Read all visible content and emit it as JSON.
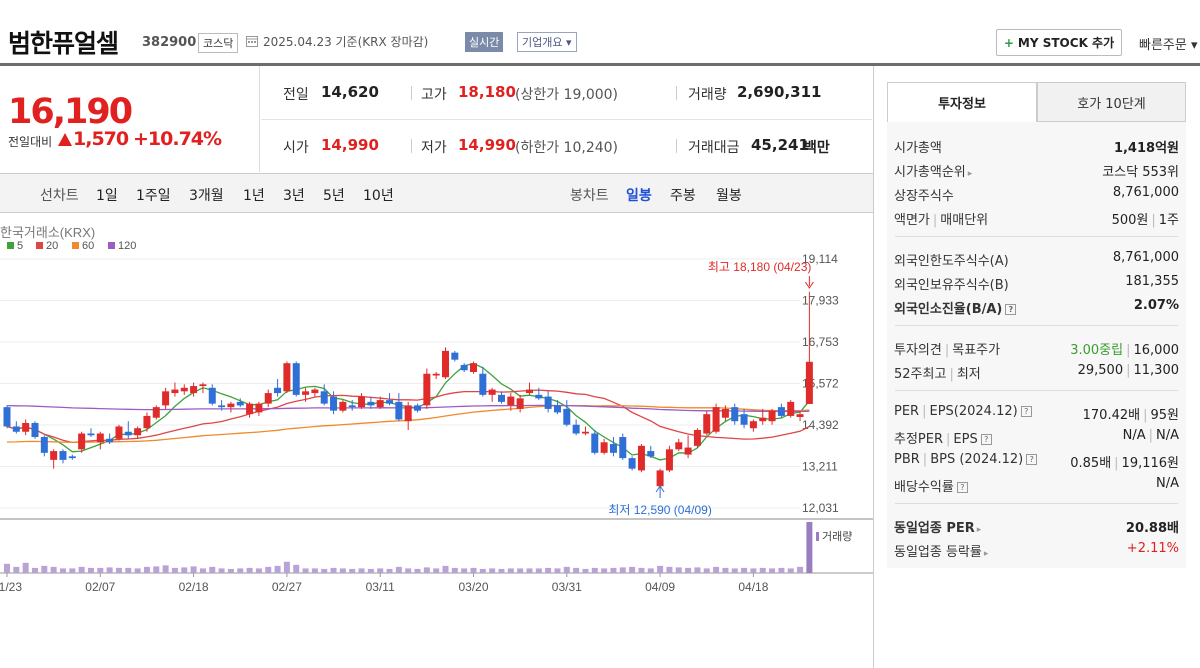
{
  "header": {
    "stock_name": "범한퓨얼셀",
    "stock_code": "382900",
    "market": "코스닥",
    "date_text": "2025.04.23  기준(KRX 장마감)",
    "realtime_label": "실시간",
    "corp_overview_label": "기업개요 ▾",
    "my_stock_label": "MY STOCK 추가",
    "quick_order_label": "빠른주문 ▾"
  },
  "price": {
    "current": "16,190",
    "change_label": "전일대비",
    "change_value": "1,570",
    "change_pct": "+10.74%"
  },
  "quote": {
    "prev_label": "전일",
    "prev": "14,620",
    "high_label": "고가",
    "high": "18,180",
    "upper_limit": "(상한가 19,000)",
    "volume_label": "거래량",
    "volume": "2,690,311",
    "open_label": "시가",
    "open": "14,990",
    "low_label": "저가",
    "low": "14,990",
    "lower_limit": "(하한가 10,240)",
    "value_label": "거래대금",
    "value": "45,241",
    "value_unit": "백만"
  },
  "range_bar": {
    "line_label": "선차트",
    "periods": [
      "1일",
      "1주일",
      "3개월",
      "1년",
      "3년",
      "5년",
      "10년"
    ],
    "candle_label": "봉차트",
    "candle_periods": [
      "일봉",
      "주봉",
      "월봉"
    ],
    "active_candle": "일봉"
  },
  "chart_data": {
    "type": "candlestick",
    "source_label": "한국거래소(KRX)",
    "legend": [
      {
        "name": "5",
        "color": "#3ca33c"
      },
      {
        "name": "20",
        "color": "#e04545"
      },
      {
        "name": "60",
        "color": "#f08a2a"
      },
      {
        "name": "120",
        "color": "#9b5cc4"
      }
    ],
    "y_ticks": [
      19114,
      17933,
      16753,
      15572,
      14392,
      13211,
      12031
    ],
    "ylim": [
      12031,
      19114
    ],
    "x_ticks": [
      "01/23",
      "02/07",
      "02/18",
      "02/27",
      "03/11",
      "03/20",
      "03/31",
      "04/09",
      "04/18"
    ],
    "x_tick_index": [
      0,
      10,
      20,
      30,
      40,
      50,
      60,
      70,
      80
    ],
    "high_annotation": "최고 18,180 (04/23)",
    "low_annotation": "최저 12,590 (04/09)",
    "volume_label": "거래량",
    "candles": [
      [
        14900,
        14950,
        14300,
        14350
      ],
      [
        14350,
        14500,
        14150,
        14200
      ],
      [
        14200,
        14550,
        14100,
        14450
      ],
      [
        14450,
        14500,
        14000,
        14050
      ],
      [
        14050,
        14100,
        13500,
        13600
      ],
      [
        13400,
        13700,
        13150,
        13650
      ],
      [
        13650,
        13700,
        13300,
        13400
      ],
      [
        13500,
        13550,
        13400,
        13450
      ],
      [
        13700,
        14200,
        13600,
        14150
      ],
      [
        14150,
        14300,
        14050,
        14100
      ],
      [
        13900,
        14200,
        13700,
        14150
      ],
      [
        14000,
        14150,
        13850,
        13900
      ],
      [
        14000,
        14400,
        13950,
        14350
      ],
      [
        14200,
        14500,
        14000,
        14100
      ],
      [
        14100,
        14350,
        14000,
        14300
      ],
      [
        14300,
        14750,
        14200,
        14650
      ],
      [
        14600,
        14950,
        14550,
        14900
      ],
      [
        14950,
        15450,
        14850,
        15350
      ],
      [
        15300,
        15600,
        15200,
        15400
      ],
      [
        15350,
        15550,
        15250,
        15450
      ],
      [
        15300,
        15600,
        15200,
        15500
      ],
      [
        15500,
        15600,
        15300,
        15550
      ],
      [
        15450,
        15550,
        14950,
        15000
      ],
      [
        14950,
        15100,
        14800,
        14900
      ],
      [
        14900,
        15050,
        14750,
        15000
      ],
      [
        15050,
        15150,
        14900,
        14950
      ],
      [
        14700,
        15050,
        14600,
        15000
      ],
      [
        14750,
        15050,
        14650,
        15000
      ],
      [
        15000,
        15400,
        14900,
        15300
      ],
      [
        15450,
        15700,
        15200,
        15300
      ],
      [
        15350,
        16200,
        15300,
        16150
      ],
      [
        16150,
        16200,
        15200,
        15250
      ],
      [
        15250,
        15450,
        15050,
        15350
      ],
      [
        15300,
        15450,
        15200,
        15400
      ],
      [
        15350,
        15550,
        14950,
        15000
      ],
      [
        15200,
        15350,
        14700,
        14800
      ],
      [
        14800,
        15100,
        14750,
        15050
      ],
      [
        14950,
        15100,
        14800,
        14900
      ],
      [
        14900,
        15300,
        14850,
        15200
      ],
      [
        15050,
        15200,
        14850,
        14950
      ],
      [
        14900,
        15200,
        14850,
        15100
      ],
      [
        15100,
        15300,
        14950,
        15000
      ],
      [
        15050,
        15300,
        14500,
        14550
      ],
      [
        14500,
        15050,
        14250,
        14950
      ],
      [
        14950,
        15000,
        14750,
        14800
      ],
      [
        14950,
        16000,
        14850,
        15850
      ],
      [
        15800,
        15900,
        15700,
        15850
      ],
      [
        15750,
        16600,
        15700,
        16500
      ],
      [
        16450,
        16500,
        16200,
        16250
      ],
      [
        16100,
        16150,
        15900,
        15950
      ],
      [
        15900,
        16200,
        15850,
        16150
      ],
      [
        15850,
        16050,
        15200,
        15250
      ],
      [
        15250,
        15450,
        15050,
        15400
      ],
      [
        15250,
        15350,
        15000,
        15050
      ],
      [
        14950,
        15300,
        14800,
        15200
      ],
      [
        14850,
        15250,
        14750,
        15150
      ],
      [
        15300,
        15600,
        15250,
        15400
      ],
      [
        15250,
        15450,
        15100,
        15150
      ],
      [
        15200,
        15350,
        14750,
        14850
      ],
      [
        14950,
        15100,
        14700,
        14750
      ],
      [
        14850,
        15100,
        14350,
        14400
      ],
      [
        14400,
        14550,
        14100,
        14150
      ],
      [
        14150,
        14350,
        14100,
        14200
      ],
      [
        14150,
        14250,
        13550,
        13600
      ],
      [
        13600,
        14000,
        13550,
        13900
      ],
      [
        13850,
        14050,
        13500,
        13600
      ],
      [
        14050,
        14150,
        13400,
        13450
      ],
      [
        13450,
        13500,
        13100,
        13150
      ],
      [
        13100,
        13850,
        13050,
        13800
      ],
      [
        13650,
        13800,
        13450,
        13500
      ],
      [
        12650,
        13150,
        12590,
        13100
      ],
      [
        13100,
        13800,
        13050,
        13700
      ],
      [
        13700,
        14000,
        13650,
        13900
      ],
      [
        13550,
        14100,
        13450,
        13750
      ],
      [
        13800,
        14300,
        13750,
        14250
      ],
      [
        14150,
        14800,
        14100,
        14700
      ],
      [
        14200,
        15000,
        14150,
        14900
      ],
      [
        14600,
        14950,
        14500,
        14850
      ],
      [
        14900,
        15000,
        14400,
        14500
      ],
      [
        14700,
        14850,
        14300,
        14400
      ],
      [
        14300,
        14550,
        14200,
        14500
      ],
      [
        14500,
        14850,
        14400,
        14600
      ],
      [
        14500,
        14850,
        14400,
        14800
      ],
      [
        14900,
        15000,
        14600,
        14650
      ],
      [
        14650,
        15100,
        14600,
        15050
      ],
      [
        14620,
        14780,
        14500,
        14700
      ],
      [
        14990,
        18180,
        14990,
        16190
      ]
    ],
    "volumes": [
      18,
      12,
      20,
      10,
      14,
      12,
      9,
      9,
      12,
      10,
      10,
      11,
      10,
      10,
      9,
      12,
      13,
      15,
      10,
      11,
      13,
      9,
      12,
      9,
      8,
      9,
      10,
      9,
      12,
      14,
      22,
      16,
      9,
      9,
      8,
      10,
      9,
      8,
      9,
      8,
      9,
      8,
      12,
      9,
      8,
      11,
      9,
      14,
      10,
      9,
      10,
      8,
      9,
      8,
      9,
      9,
      9,
      9,
      10,
      9,
      12,
      10,
      8,
      10,
      9,
      10,
      11,
      12,
      10,
      9,
      14,
      12,
      11,
      10,
      11,
      9,
      12,
      10,
      9,
      10,
      9,
      10,
      9,
      10,
      9,
      12,
      100
    ]
  },
  "tabs": {
    "invest_info": "투자정보",
    "hoga": "호가 10단계"
  },
  "info": {
    "market_cap_label": "시가총액",
    "market_cap": "1,418억원",
    "market_cap_rank_label": "시가총액순위",
    "market_cap_rank": "코스닥 553위",
    "shares_label": "상장주식수",
    "shares": "8,761,000",
    "face_label_a": "액면가",
    "face_label_b": "매매단위",
    "face_value": "500원",
    "trade_unit": "1주",
    "foreign_limit_label": "외국인한도주식수(A)",
    "foreign_limit": "8,761,000",
    "foreign_hold_label": "외국인보유주식수(B)",
    "foreign_hold": "181,355",
    "foreign_ratio_label": "외국인소진율(B/A)",
    "foreign_ratio": "2.07%",
    "opinion_label_a": "투자의견",
    "opinion_label_b": "목표주가",
    "opinion": "3.00중립",
    "target": "16,000",
    "w52_label_a": "52주최고",
    "w52_label_b": "최저",
    "w52_high": "29,500",
    "w52_low": "11,300",
    "per_label_a": "PER",
    "per_label_b": "EPS(2024.12)",
    "per": "170.42배",
    "eps": "95원",
    "est_label_a": "추정PER",
    "est_label_b": "EPS",
    "est_per": "N/A",
    "est_eps": "N/A",
    "pbr_label_a": "PBR",
    "pbr_label_b": "BPS (2024.12)",
    "pbr": "0.85배",
    "bps": "19,116원",
    "div_label": "배당수익률",
    "div": "N/A",
    "peer_per_label": "동일업종 PER",
    "peer_per": "20.88배",
    "peer_chg_label": "동일업종 등락률",
    "peer_chg": "+2.11%"
  }
}
